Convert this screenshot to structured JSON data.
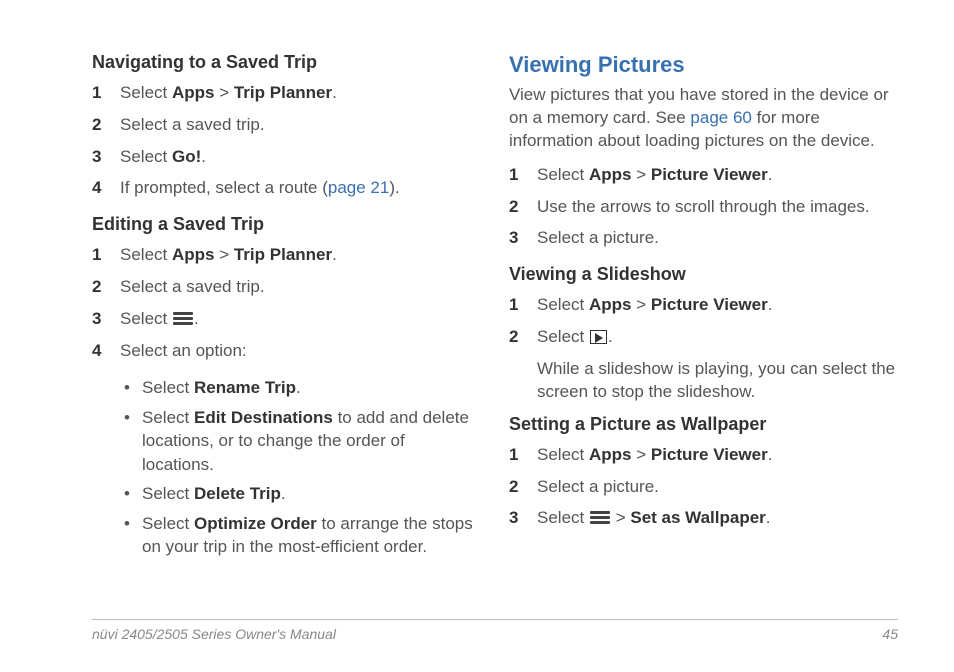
{
  "left": {
    "section1": {
      "heading": "Navigating to a Saved Trip",
      "steps": [
        {
          "num": "1",
          "pre": "Select ",
          "b1": "Apps",
          "mid": " > ",
          "b2": "Trip Planner",
          "post": "."
        },
        {
          "num": "2",
          "pre": "Select a saved trip."
        },
        {
          "num": "3",
          "pre": "Select ",
          "b1": "Go!",
          "post": "."
        },
        {
          "num": "4",
          "pre": "If prompted, select a route (",
          "link": "page 21",
          "post2": ")."
        }
      ]
    },
    "section2": {
      "heading": "Editing a Saved Trip",
      "steps": [
        {
          "num": "1",
          "pre": "Select ",
          "b1": "Apps",
          "mid": " > ",
          "b2": "Trip Planner",
          "post": "."
        },
        {
          "num": "2",
          "pre": "Select a saved trip."
        },
        {
          "num": "3",
          "pre": "Select ",
          "icon": "menu",
          "post": "."
        },
        {
          "num": "4",
          "pre": "Select an option:"
        }
      ],
      "bullets": [
        {
          "pre": "Select ",
          "b1": "Rename Trip",
          "post": "."
        },
        {
          "pre": "Select ",
          "b1": "Edit Destinations",
          "post": " to add and delete locations, or to change the order of locations."
        },
        {
          "pre": "Select ",
          "b1": "Delete Trip",
          "post": "."
        },
        {
          "pre": "Select ",
          "b1": "Optimize Order",
          "post": " to arrange the stops on your trip in the most-efficient order."
        }
      ]
    }
  },
  "right": {
    "heading": "Viewing Pictures",
    "intro": {
      "pre": "View pictures that you have stored in the device or on a memory card. See ",
      "link": "page 60",
      "post": " for more information about loading pictures on the device."
    },
    "steps1": [
      {
        "num": "1",
        "pre": "Select ",
        "b1": "Apps",
        "mid": " > ",
        "b2": "Picture Viewer",
        "post": "."
      },
      {
        "num": "2",
        "pre": "Use the arrows to scroll through the images."
      },
      {
        "num": "3",
        "pre": "Select a picture."
      }
    ],
    "section2": {
      "heading": "Viewing a Slideshow",
      "steps": [
        {
          "num": "1",
          "pre": "Select ",
          "b1": "Apps",
          "mid": " > ",
          "b2": "Picture Viewer",
          "post": "."
        },
        {
          "num": "2",
          "pre": "Select ",
          "icon": "play",
          "post": "."
        }
      ],
      "note": "While a slideshow is playing, you can select the screen to stop the slideshow."
    },
    "section3": {
      "heading": "Setting a Picture as Wallpaper",
      "steps": [
        {
          "num": "1",
          "pre": "Select ",
          "b1": "Apps",
          "mid": " > ",
          "b2": "Picture Viewer",
          "post": "."
        },
        {
          "num": "2",
          "pre": "Select a picture."
        },
        {
          "num": "3",
          "pre": "Select ",
          "icon": "menu",
          "mid": " > ",
          "b2": "Set as Wallpaper",
          "post": "."
        }
      ]
    }
  },
  "footer": {
    "title": "nüvi 2405/2505 Series Owner's Manual",
    "page": "45"
  }
}
